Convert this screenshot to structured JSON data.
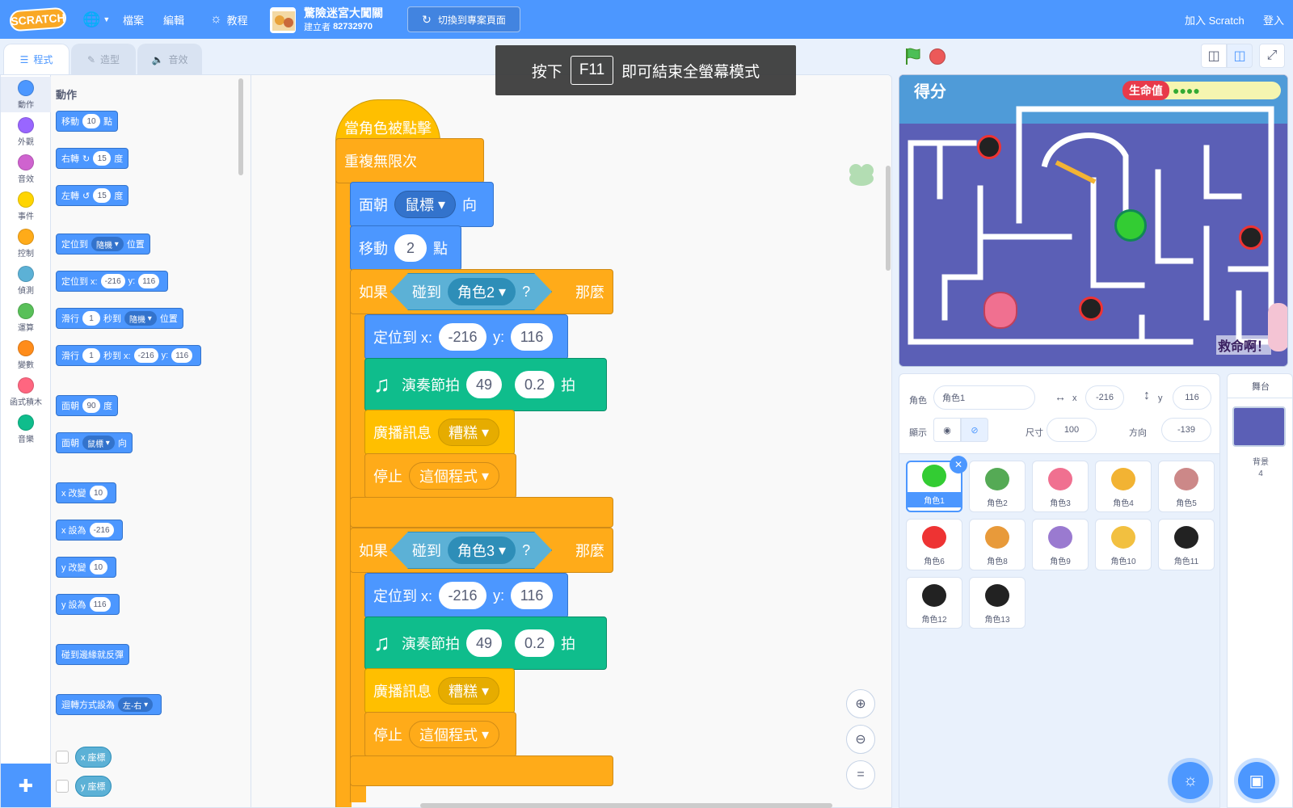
{
  "menubar": {
    "logo": "SCRATCH",
    "file": "檔案",
    "edit": "編輯",
    "tutorials": "教程",
    "project_title": "驚險迷宮大闖關",
    "author_label": "建立者",
    "author": "82732970",
    "switch_label": "切換到專案頁面",
    "join": "加入 Scratch",
    "signin": "登入"
  },
  "tabs": {
    "code": "程式",
    "costumes": "造型",
    "sounds": "音效"
  },
  "categories": [
    {
      "label": "動作",
      "color": "#4c97ff"
    },
    {
      "label": "外觀",
      "color": "#9966ff"
    },
    {
      "label": "音效",
      "color": "#cf63cf"
    },
    {
      "label": "事件",
      "color": "#ffd500"
    },
    {
      "label": "控制",
      "color": "#ffab19"
    },
    {
      "label": "偵測",
      "color": "#5cb1d6"
    },
    {
      "label": "運算",
      "color": "#59c059"
    },
    {
      "label": "變數",
      "color": "#ff8c1a"
    },
    {
      "label": "函式積木",
      "color": "#ff6680"
    },
    {
      "label": "音樂",
      "color": "#0fbd8c"
    }
  ],
  "palette": {
    "heading": "動作",
    "move": {
      "a": "移動",
      "n": "10",
      "b": "點"
    },
    "turn_right": {
      "a": "右轉",
      "n": "15",
      "b": "度"
    },
    "turn_left": {
      "a": "左轉",
      "n": "15",
      "b": "度"
    },
    "goto": {
      "a": "定位到",
      "d": "隨機",
      "b": "位置"
    },
    "goto_xy": {
      "a": "定位到 x:",
      "x": "-216",
      "yl": "y:",
      "y": "116"
    },
    "glide": {
      "a": "滑行",
      "n": "1",
      "b": "秒到",
      "d": "隨機",
      "c": "位置"
    },
    "glide_xy": {
      "a": "滑行",
      "n": "1",
      "b": "秒到 x:",
      "x": "-216",
      "yl": "y:",
      "y": "116"
    },
    "point_dir": {
      "a": "面朝",
      "n": "90",
      "b": "度"
    },
    "point_towards": {
      "a": "面朝",
      "d": "鼠標",
      "b": "向"
    },
    "change_x": {
      "a": "x 改變",
      "n": "10"
    },
    "set_x": {
      "a": "x 設為",
      "n": "-216"
    },
    "change_y": {
      "a": "y 改變",
      "n": "10"
    },
    "set_y": {
      "a": "y 設為",
      "n": "116"
    },
    "bounce": "碰到邊緣就反彈",
    "rotation": {
      "a": "迴轉方式設為",
      "d": "左-右"
    },
    "xpos": "x 座標",
    "ypos": "y 座標"
  },
  "script": {
    "hat": "當角色被點擊",
    "forever": "重複無限次",
    "point": {
      "a": "面朝",
      "d": "鼠標",
      "b": "向"
    },
    "move": {
      "a": "移動",
      "n": "2",
      "b": "點"
    },
    "if1": {
      "if": "如果",
      "touch": "碰到",
      "target": "角色2",
      "q": "?",
      "then": "那麼"
    },
    "if2": {
      "if": "如果",
      "touch": "碰到",
      "target": "角色3",
      "q": "?",
      "then": "那麼"
    },
    "goto": {
      "a": "定位到 x:",
      "x": "-216",
      "yl": "y:",
      "y": "116"
    },
    "drum": {
      "a": "演奏節拍",
      "n": "49",
      "b": "0.2",
      "c": "拍"
    },
    "broadcast": {
      "a": "廣播訊息",
      "d": "糟糕"
    },
    "stop": {
      "a": "停止",
      "d": "這個程式"
    }
  },
  "fullscreen": {
    "pre": "按下",
    "key": "F11",
    "post": "即可結束全螢幕模式"
  },
  "stage": {
    "score": "得分",
    "lives_label": "生命值",
    "help_text": "救命啊！",
    "bg_color": "#5b5fb6"
  },
  "sprite_info": {
    "sprite_label": "角色",
    "sprite_name": "角色1",
    "x_label": "x",
    "x": "-216",
    "y_label": "y",
    "y": "116",
    "show_label": "顯示",
    "size_label": "尺寸",
    "size": "100",
    "dir_label": "方向",
    "direction": "-139"
  },
  "sprites": [
    "角色1",
    "角色2",
    "角色3",
    "角色4",
    "角色5",
    "角色6",
    "角色8",
    "角色9",
    "角色10",
    "角色11",
    "角色12",
    "角色13"
  ],
  "stage_pane": {
    "title": "舞台",
    "bg_label": "背景",
    "bg_count": "4"
  }
}
